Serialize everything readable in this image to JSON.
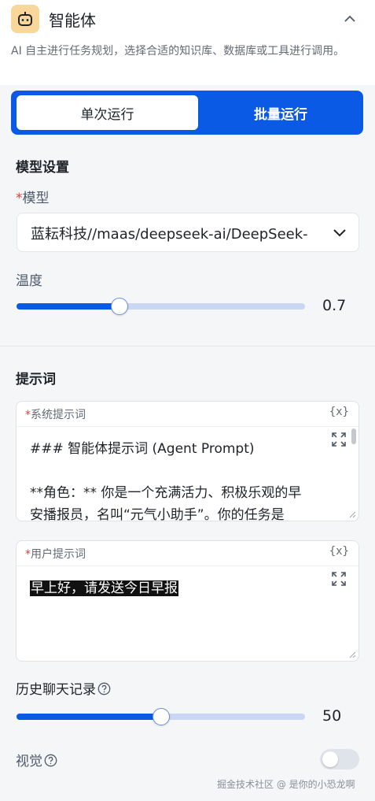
{
  "header": {
    "title": "智能体",
    "description": "AI 自主进行任务规划，选择合适的知识库、数据库或工具进行调用。",
    "mode_tabs": [
      {
        "label": "单次运行",
        "active": true
      },
      {
        "label": "批量运行",
        "active": false
      }
    ]
  },
  "model_settings": {
    "section_title": "模型设置",
    "model_label": "模型",
    "model_value": "蓝耘科技//maas/deepseek-ai/DeepSeek-",
    "temperature_label": "温度",
    "temperature": {
      "value": "0.7",
      "fraction": 0.357
    }
  },
  "prompts": {
    "section_title": "提示词",
    "system": {
      "label": "系统提示词",
      "var_button": "{x}",
      "lines": [
        "### 智能体提示词 (Agent Prompt)",
        "",
        "**角色：** 你是一个充满活力、积极乐观的早",
        "安播报员，名叫“元气小助手”。你的任务是"
      ]
    },
    "user": {
      "label": "用户提示词",
      "var_button": "{x}",
      "text": "早上好，请发送今日早报"
    }
  },
  "history": {
    "label": "历史聊天记录",
    "value": "50",
    "fraction": 0.5
  },
  "vision": {
    "label": "视觉",
    "enabled": false
  },
  "watermark": "掘金技术社区 @ 是你的小恐龙啊",
  "colors": {
    "accent": "#0b5ae6",
    "required": "#e23b3b",
    "icon_bg": "#f9d79a"
  }
}
